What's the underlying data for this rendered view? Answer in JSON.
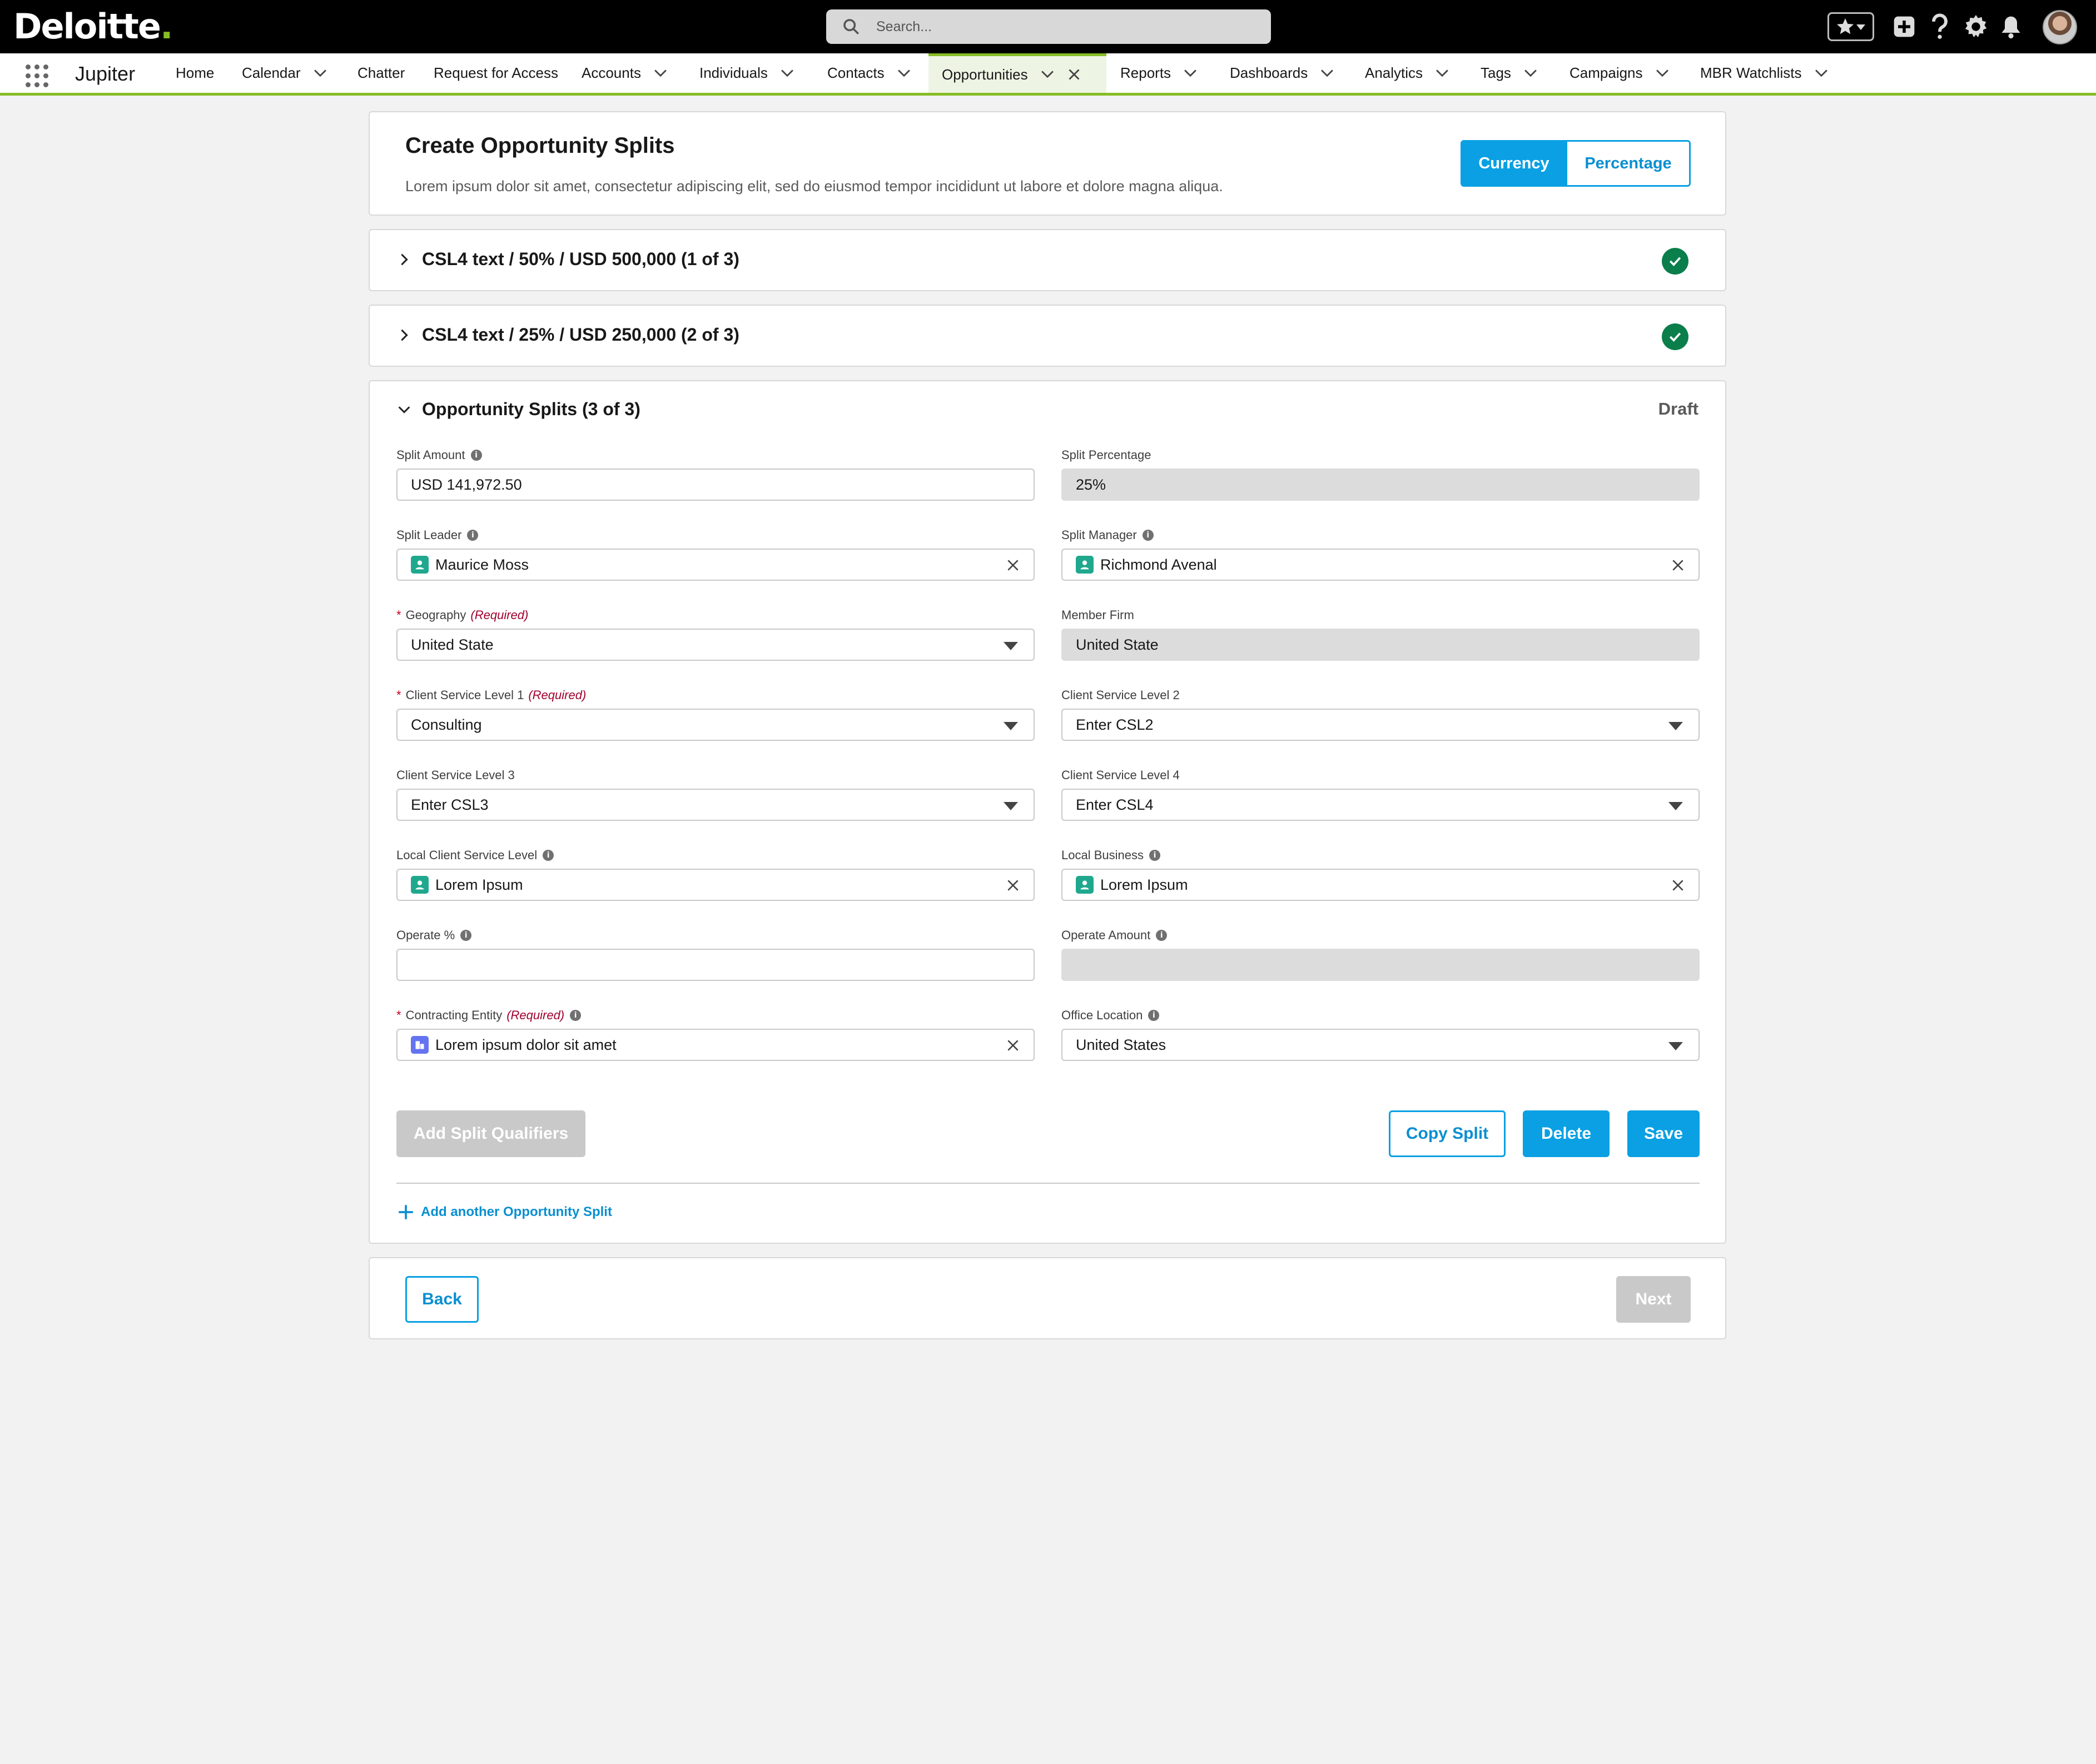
{
  "topbar": {
    "brand": "Deloitte",
    "brand_dot": ".",
    "search_placeholder": "Search..."
  },
  "nav": {
    "app_name": "Jupiter",
    "items": [
      {
        "label": "Home"
      },
      {
        "label": "Calendar"
      },
      {
        "label": "Chatter"
      },
      {
        "label": "Request for Access"
      },
      {
        "label": "Accounts"
      },
      {
        "label": "Individuals"
      },
      {
        "label": "Contacts"
      },
      {
        "label": "Opportunities"
      },
      {
        "label": "Reports"
      },
      {
        "label": "Dashboards"
      },
      {
        "label": "Analytics"
      },
      {
        "label": "Tags"
      },
      {
        "label": "Campaigns"
      },
      {
        "label": "MBR Watchlists"
      }
    ]
  },
  "header": {
    "title": "Create Opportunity Splits",
    "description": "Lorem ipsum dolor sit amet, consectetur adipiscing elit, sed do eiusmod tempor incididunt ut labore et dolore magna aliqua.",
    "toggle_currency": "Currency",
    "toggle_percentage": "Percentage"
  },
  "splits": [
    {
      "label": "CSL4 text / 50% / USD 500,000 (1 of 3)"
    },
    {
      "label": "CSL4 text / 25% / USD 250,000 (2 of 3)"
    }
  ],
  "form": {
    "heading": "Opportunity Splits (3 of 3)",
    "status": "Draft",
    "required_text": "(Required)",
    "required_mark": "*",
    "info_glyph": "i",
    "split_amount": {
      "label": "Split Amount",
      "value": "USD 141,972.50"
    },
    "split_percentage": {
      "label": "Split Percentage",
      "value": "25%"
    },
    "split_leader": {
      "label": "Split Leader",
      "value": "Maurice Moss"
    },
    "split_manager": {
      "label": "Split Manager",
      "value": "Richmond Avenal"
    },
    "geography": {
      "label": "Geography",
      "value": "United State"
    },
    "member_firm": {
      "label": "Member Firm",
      "value": "United State"
    },
    "csl1": {
      "label": "Client Service Level 1",
      "value": "Consulting"
    },
    "csl2": {
      "label": "Client Service Level 2",
      "value": "Enter CSL2"
    },
    "csl3": {
      "label": "Client Service Level 3",
      "value": "Enter CSL3"
    },
    "csl4": {
      "label": "Client Service Level 4",
      "value": "Enter CSL4"
    },
    "local_csl": {
      "label": "Local Client Service Level",
      "value": "Lorem Ipsum"
    },
    "local_business": {
      "label": "Local Business",
      "value": "Lorem Ipsum"
    },
    "operate_pct": {
      "label": "Operate %",
      "value": ""
    },
    "operate_amount": {
      "label": "Operate Amount",
      "value": ""
    },
    "contracting_entity": {
      "label": "Contracting Entity",
      "value": "Lorem ipsum dolor sit amet"
    },
    "office_location": {
      "label": "Office Location",
      "value": "United States"
    },
    "add_qualifiers": "Add Split Qualifiers",
    "copy_split": "Copy Split",
    "delete": "Delete",
    "save": "Save",
    "add_another": "Add another Opportunity Split"
  },
  "footer": {
    "back": "Back",
    "next": "Next"
  },
  "colors": {
    "brand_green": "#86bc25",
    "primary_blue": "#0aa0e3",
    "success_green": "#0a7e4b",
    "required_red": "#c2001b"
  }
}
